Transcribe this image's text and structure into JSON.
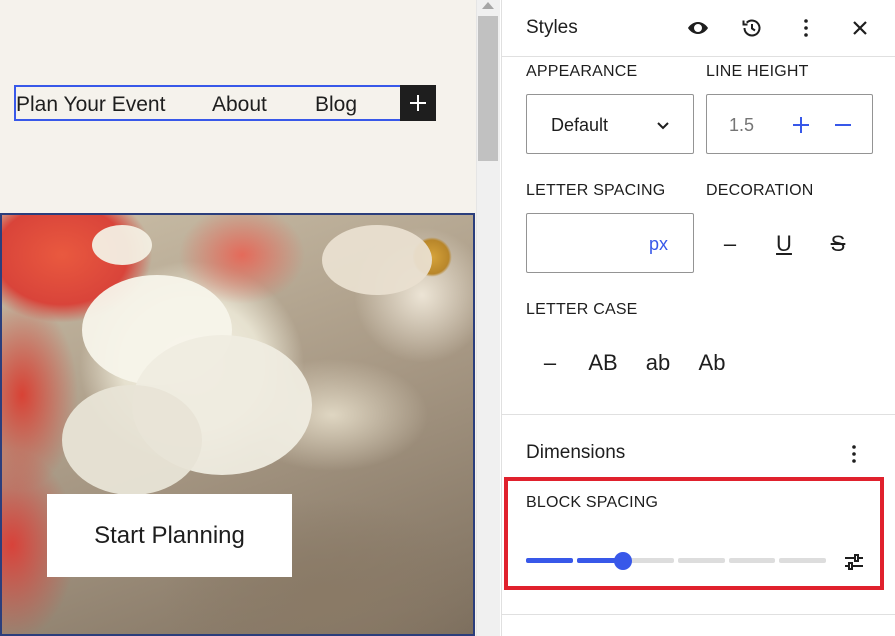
{
  "canvas": {
    "nav": {
      "items": [
        "Plan Your Event",
        "About",
        "Blog"
      ],
      "add_icon": "plus-icon"
    },
    "cover": {
      "cta_label": "Start Planning"
    }
  },
  "sidebar": {
    "title": "Styles",
    "header_icons": [
      "eye-icon",
      "history-icon",
      "more-vertical-icon",
      "close-icon"
    ],
    "typography": {
      "appearance_label": "APPEARANCE",
      "appearance_value": "Default",
      "line_height_label": "LINE HEIGHT",
      "line_height_value": "1.5",
      "letter_spacing_label": "LETTER SPACING",
      "letter_spacing_value": "",
      "letter_spacing_unit": "px",
      "decoration_label": "DECORATION",
      "decoration_options": [
        "–",
        "U",
        "S"
      ],
      "letter_case_label": "LETTER CASE",
      "letter_case_options": [
        "–",
        "AB",
        "ab",
        "Ab"
      ]
    },
    "dimensions": {
      "title": "Dimensions",
      "block_spacing_label": "BLOCK SPACING",
      "block_spacing_level": 2,
      "block_spacing_steps": 6
    }
  },
  "colors": {
    "accent": "#3858e9",
    "highlight": "#e0212d",
    "canvas_bg": "#f5f2ec"
  }
}
